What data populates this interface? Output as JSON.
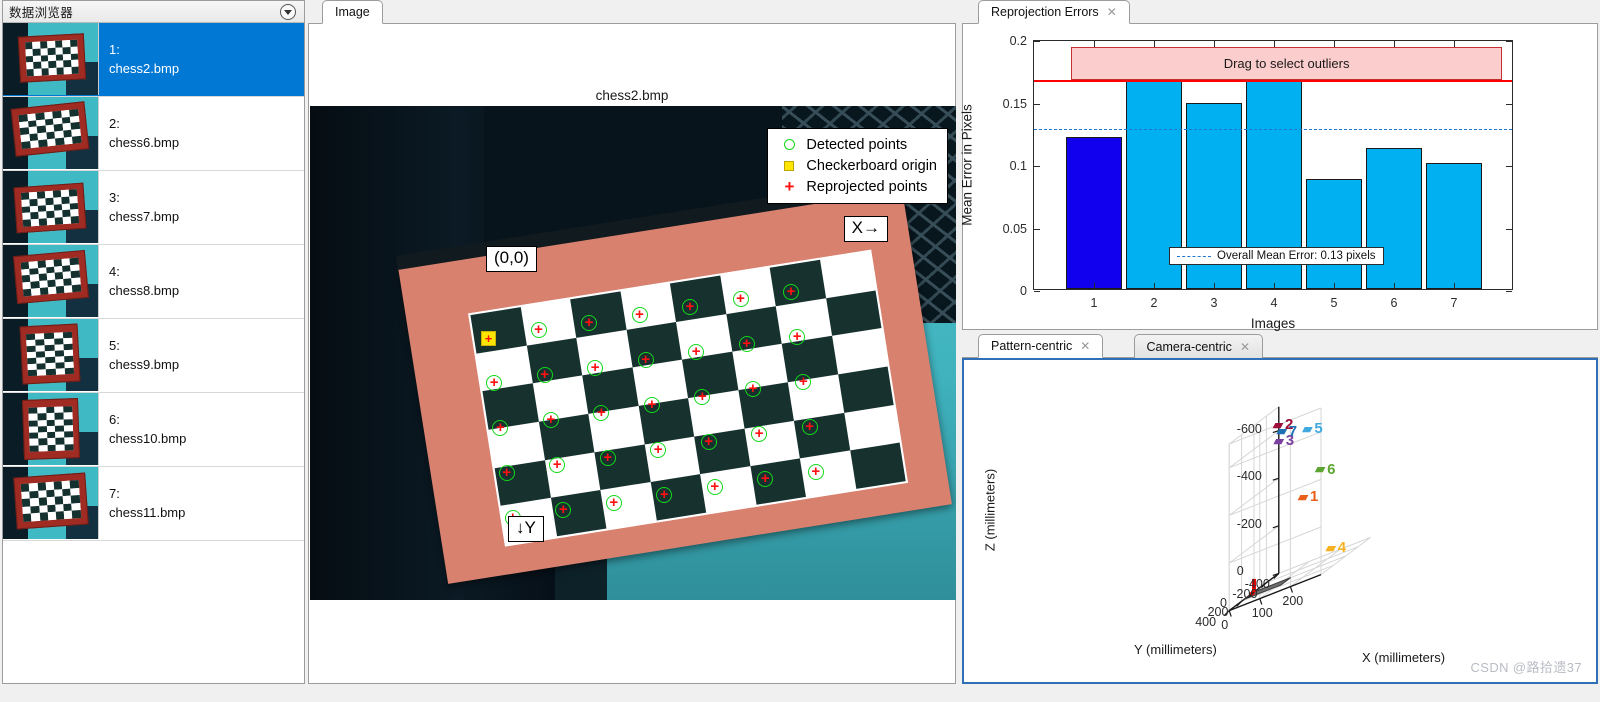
{
  "sidebar": {
    "title": "数据浏览器",
    "collapse_icon": "chevron-down-icon",
    "items": [
      {
        "index": "1:",
        "filename": "chess2.bmp",
        "selected": true
      },
      {
        "index": "2:",
        "filename": "chess6.bmp",
        "selected": false
      },
      {
        "index": "3:",
        "filename": "chess7.bmp",
        "selected": false
      },
      {
        "index": "4:",
        "filename": "chess8.bmp",
        "selected": false
      },
      {
        "index": "5:",
        "filename": "chess9.bmp",
        "selected": false
      },
      {
        "index": "6:",
        "filename": "chess10.bmp",
        "selected": false
      },
      {
        "index": "7:",
        "filename": "chess11.bmp",
        "selected": false
      }
    ]
  },
  "image_panel": {
    "tab_label": "Image",
    "title": "chess2.bmp",
    "annotations": {
      "origin": "(0,0)",
      "x_axis": "X→",
      "y_axis": "↓Y"
    },
    "legend": {
      "detected": "Detected points",
      "origin": "Checkerboard origin",
      "reprojected": "Reprojected points",
      "detected_color": "#14d81b",
      "origin_color": "#ffe500",
      "reprojected_color": "#ff1111"
    }
  },
  "reprojection_panel": {
    "tab_label": "Reprojection Errors",
    "close_icon": "close-icon",
    "drag_band_label": "Drag to select outliers",
    "legend_label": "Overall Mean Error: 0.13 pixels"
  },
  "chart_data": {
    "type": "bar",
    "title": "Reprojection Errors",
    "categories": [
      "1",
      "2",
      "3",
      "4",
      "5",
      "6",
      "7"
    ],
    "values": [
      0.122,
      0.169,
      0.149,
      0.169,
      0.088,
      0.113,
      0.101
    ],
    "selected_index": 0,
    "bar_color": "#00b0f0",
    "selected_bar_color": "#1100ee",
    "xlabel": "Images",
    "ylabel": "Mean Error in Pixels",
    "ylim": [
      0,
      0.2
    ],
    "yticks": [
      0,
      0.05,
      0.1,
      0.15,
      0.2
    ],
    "ytick_labels": [
      "0",
      "0.05",
      "0.1",
      "0.15",
      "0.2"
    ],
    "mean_error": 0.13,
    "mean_error_label": "Overall Mean Error: 0.13 pixels",
    "mean_line_color": "#1f77d0",
    "outlier_threshold": 0.169,
    "outlier_line_color": "#ff0000",
    "grid": false,
    "legend_position": "inside-bottom-center"
  },
  "extrinsics_panel": {
    "tabs": [
      {
        "label": "Pattern-centric",
        "active": true,
        "close_icon": "close-icon"
      },
      {
        "label": "Camera-centric",
        "active": false,
        "close_icon": "close-icon"
      }
    ],
    "plot": {
      "type": "scatter3d",
      "xlabel": "X (millimeters)",
      "ylabel": "Y (millimeters)",
      "zlabel": "Z (millimeters)",
      "xticks": [
        "0",
        "100",
        "200"
      ],
      "yticks": [
        "-400",
        "-200",
        "0",
        "200",
        "400"
      ],
      "zticks": [
        "-600",
        "-400",
        "-200",
        "0"
      ],
      "cameras": [
        {
          "label": "1",
          "color": "#e8601c"
        },
        {
          "label": "2",
          "color": "#9e0f3a"
        },
        {
          "label": "3",
          "color": "#7b3fa0"
        },
        {
          "label": "4",
          "color": "#f5b323"
        },
        {
          "label": "5",
          "color": "#3fa9e0"
        },
        {
          "label": "6",
          "color": "#5da533"
        },
        {
          "label": "7",
          "color": "#1f6fb5"
        }
      ],
      "origin_marker_color": "#ff0000",
      "board_color": "#6e6e6e"
    }
  },
  "watermark": "CSDN @路拾遗37"
}
